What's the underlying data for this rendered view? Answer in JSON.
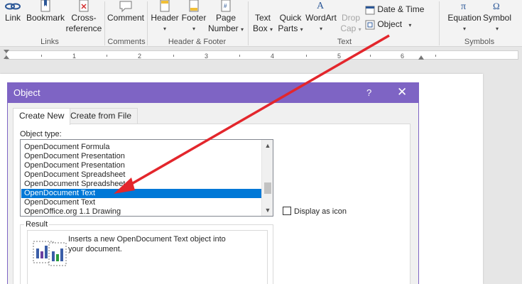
{
  "ribbon": {
    "link": "Link",
    "bookmark": "Bookmark",
    "cross_reference_1": "Cross-",
    "cross_reference_2": "reference",
    "comment": "Comment",
    "header": "Header",
    "footer": "Footer",
    "page_number_1": "Page",
    "page_number_2": "Number",
    "text_box_1": "Text",
    "text_box_2": "Box",
    "quick_parts_1": "Quick",
    "quick_parts_2": "Parts",
    "wordart": "WordArt",
    "drop_cap_1": "Drop",
    "drop_cap_2": "Cap",
    "date_time": "Date & Time",
    "object": "Object",
    "equation": "Equation",
    "symbol": "Symbol",
    "groups": {
      "links": "Links",
      "comments": "Comments",
      "header_footer": "Header & Footer",
      "text": "Text",
      "symbols": "Symbols"
    }
  },
  "ruler": {
    "numbers": [
      "1",
      "2",
      "3",
      "4",
      "5",
      "6"
    ]
  },
  "dialog": {
    "title": "Object",
    "help": "?",
    "close": "✕",
    "tabs": [
      "Create New",
      "Create from File"
    ],
    "object_type_label": "Object type:",
    "object_types": [
      "OpenDocument Formula",
      "OpenDocument Presentation",
      "OpenDocument Presentation",
      "OpenDocument Spreadsheet",
      "OpenDocument Spreadsheet",
      "OpenDocument Text",
      "OpenDocument Text",
      "OpenOffice.org 1.1 Drawing"
    ],
    "selected_index": 5,
    "display_as_icon": "Display as icon",
    "display_as_icon_checked": false,
    "result_label": "Result",
    "result_text": "Inserts a new OpenDocument Text object into your document."
  },
  "colors": {
    "dialog_title": "#7e64c4",
    "selection": "#0078d7",
    "arrow": "#e3262c"
  }
}
